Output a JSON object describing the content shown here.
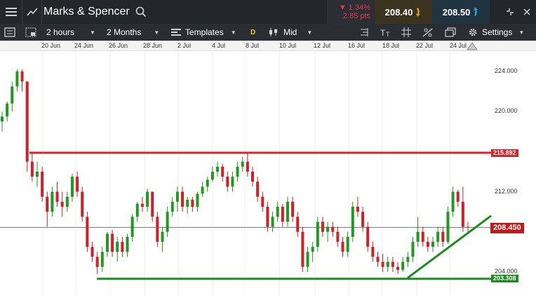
{
  "header": {
    "instrument": "Marks & Spencer",
    "change_pct": "▼ 1.34%",
    "change_pts": "2.85 pts",
    "sell_price": "208.40",
    "buy_price": "208.50"
  },
  "toolbar": {
    "interval": "2 hours",
    "range": "2 Months",
    "templates": "Templates",
    "d_badge": "D",
    "price_type": "Mid",
    "settings": "Settings"
  },
  "chart_data": {
    "type": "candlestick",
    "x_ticks": [
      "20 Jun",
      "24 Jun",
      "26 Jun",
      "28 Jun",
      "2 Jul",
      "4 Jul",
      "8 Jul",
      "10 Jul",
      "12 Jul",
      "16 Jul",
      "18 Jul",
      "22 Jul",
      "24 Jul"
    ],
    "y_ticks": [
      "224.000",
      "220.000",
      "212.000",
      "204.000"
    ],
    "ylim": [
      202,
      226
    ],
    "lines": [
      {
        "label": "215.892",
        "value": 215.892,
        "color": "#d8232a"
      },
      {
        "label": "203.308",
        "value": 203.308,
        "color": "#1f8a1f"
      }
    ],
    "last_price": {
      "label": "208.450",
      "value": 208.45,
      "color": "#c01a1a"
    },
    "trendline": {
      "from": 203.4,
      "to": 209.6,
      "color": "#1f8a1f"
    },
    "candles": [
      [
        219.0,
        220.0,
        218.0,
        219.5
      ],
      [
        219.5,
        221.0,
        219.0,
        220.8
      ],
      [
        220.8,
        223.0,
        220.0,
        222.5
      ],
      [
        222.5,
        224.2,
        222.0,
        224.0
      ],
      [
        224.0,
        224.2,
        222.0,
        223.0
      ],
      [
        223.0,
        223.0,
        214.0,
        215.0
      ],
      [
        215.0,
        216.0,
        213.0,
        213.5
      ],
      [
        213.5,
        215.0,
        212.5,
        214.0
      ],
      [
        214.0,
        214.5,
        211.0,
        211.5
      ],
      [
        211.5,
        212.0,
        208.5,
        210.0
      ],
      [
        210.0,
        212.5,
        209.5,
        212.0
      ],
      [
        212.0,
        213.0,
        210.5,
        211.0
      ],
      [
        211.0,
        212.0,
        209.5,
        210.5
      ],
      [
        210.5,
        212.0,
        210.0,
        211.5
      ],
      [
        211.5,
        213.8,
        211.0,
        213.5
      ],
      [
        213.5,
        214.0,
        211.5,
        212.0
      ],
      [
        212.0,
        212.5,
        209.0,
        209.5
      ],
      [
        209.5,
        210.0,
        206.0,
        206.5
      ],
      [
        206.5,
        207.0,
        205.0,
        205.5
      ],
      [
        205.5,
        206.0,
        203.8,
        204.5
      ],
      [
        204.5,
        206.5,
        204.0,
        206.0
      ],
      [
        206.0,
        208.0,
        205.5,
        207.8
      ],
      [
        207.8,
        208.2,
        205.5,
        206.0
      ],
      [
        206.0,
        207.5,
        205.0,
        207.0
      ],
      [
        207.0,
        207.5,
        205.5,
        206.0
      ],
      [
        206.0,
        207.8,
        205.5,
        207.5
      ],
      [
        207.5,
        209.8,
        207.0,
        209.5
      ],
      [
        209.5,
        211.0,
        209.0,
        210.8
      ],
      [
        210.8,
        211.5,
        210.0,
        210.5
      ],
      [
        210.5,
        212.3,
        210.0,
        212.0
      ],
      [
        212.0,
        212.0,
        209.0,
        209.5
      ],
      [
        209.5,
        210.0,
        206.5,
        207.0
      ],
      [
        207.0,
        208.5,
        206.0,
        208.0
      ],
      [
        208.0,
        210.5,
        207.5,
        210.0
      ],
      [
        210.0,
        211.5,
        209.5,
        211.0
      ],
      [
        211.0,
        212.5,
        210.0,
        212.0
      ],
      [
        212.0,
        212.5,
        210.0,
        210.5
      ],
      [
        210.5,
        211.5,
        209.8,
        211.2
      ],
      [
        211.2,
        211.5,
        210.0,
        210.5
      ],
      [
        210.5,
        212.0,
        210.0,
        211.8
      ],
      [
        211.8,
        213.0,
        211.5,
        212.5
      ],
      [
        212.5,
        213.5,
        212.0,
        213.2
      ],
      [
        213.2,
        214.5,
        213.0,
        214.0
      ],
      [
        214.0,
        215.0,
        213.5,
        214.5
      ],
      [
        214.5,
        214.8,
        213.0,
        213.5
      ],
      [
        213.5,
        214.0,
        212.0,
        212.5
      ],
      [
        212.5,
        214.0,
        212.0,
        213.5
      ],
      [
        213.5,
        215.0,
        213.0,
        214.5
      ],
      [
        214.5,
        215.5,
        214.0,
        215.0
      ],
      [
        215.0,
        215.9,
        213.5,
        214.0
      ],
      [
        214.0,
        214.5,
        212.5,
        213.0
      ],
      [
        213.0,
        213.5,
        211.0,
        211.5
      ],
      [
        211.5,
        212.0,
        210.0,
        210.5
      ],
      [
        210.5,
        211.0,
        208.0,
        208.5
      ],
      [
        208.5,
        210.0,
        208.0,
        209.5
      ],
      [
        209.5,
        211.0,
        209.0,
        210.5
      ],
      [
        210.5,
        210.8,
        208.5,
        209.0
      ],
      [
        209.0,
        211.5,
        208.5,
        211.0
      ],
      [
        211.0,
        211.5,
        209.0,
        209.5
      ],
      [
        209.5,
        210.0,
        207.5,
        208.0
      ],
      [
        208.0,
        208.5,
        204.0,
        204.5
      ],
      [
        204.5,
        206.5,
        204.0,
        206.0
      ],
      [
        206.0,
        207.0,
        205.0,
        206.5
      ],
      [
        206.5,
        209.5,
        206.0,
        209.0
      ],
      [
        209.0,
        209.5,
        207.5,
        208.0
      ],
      [
        208.0,
        209.0,
        207.0,
        208.5
      ],
      [
        208.5,
        209.0,
        207.5,
        208.0
      ],
      [
        208.0,
        208.5,
        206.5,
        207.0
      ],
      [
        207.0,
        207.5,
        205.5,
        206.0
      ],
      [
        206.0,
        208.0,
        205.5,
        207.5
      ],
      [
        207.5,
        211.0,
        207.0,
        210.5
      ],
      [
        210.5,
        211.5,
        209.5,
        210.0
      ],
      [
        210.0,
        210.5,
        208.0,
        208.5
      ],
      [
        208.5,
        209.0,
        206.0,
        206.5
      ],
      [
        206.5,
        207.0,
        205.0,
        205.5
      ],
      [
        205.5,
        206.0,
        204.5,
        205.0
      ],
      [
        205.0,
        205.8,
        204.0,
        204.5
      ],
      [
        204.5,
        205.5,
        204.0,
        205.0
      ],
      [
        205.0,
        205.5,
        204.0,
        204.5
      ],
      [
        204.5,
        205.0,
        203.8,
        204.2
      ],
      [
        204.2,
        205.5,
        204.0,
        205.0
      ],
      [
        205.0,
        206.0,
        204.5,
        205.5
      ],
      [
        205.5,
        207.5,
        205.0,
        207.0
      ],
      [
        207.0,
        209.5,
        206.5,
        208.0
      ],
      [
        208.0,
        208.5,
        206.5,
        207.0
      ],
      [
        207.0,
        207.5,
        206.0,
        206.5
      ],
      [
        206.5,
        207.5,
        206.0,
        207.0
      ],
      [
        207.0,
        208.5,
        206.5,
        208.0
      ],
      [
        208.0,
        208.5,
        206.5,
        207.0
      ],
      [
        207.0,
        210.5,
        206.8,
        210.0
      ],
      [
        210.0,
        212.5,
        209.5,
        212.0
      ],
      [
        212.0,
        212.2,
        210.5,
        211.0
      ],
      [
        211.0,
        212.5,
        208.0,
        208.5
      ],
      [
        208.5,
        209.0,
        208.0,
        208.45
      ]
    ]
  },
  "colors": {
    "up": "#1f9a1f",
    "down": "#d21f26",
    "header_bg": "#23272c"
  }
}
